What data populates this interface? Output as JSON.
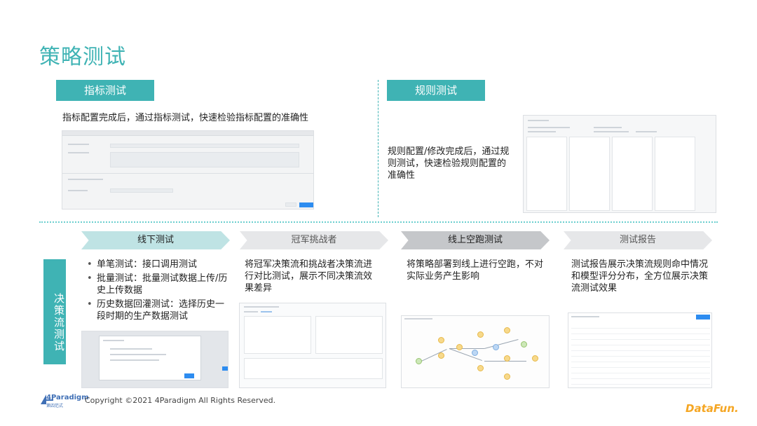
{
  "page": {
    "title": "策略测试"
  },
  "indicator_test": {
    "tag": "指标测试",
    "description": "指标配置完成后，通过指标测试，快速检验指标配置的准确性"
  },
  "rule_test": {
    "tag": "规则测试",
    "description": "规则配置/修改完成后，通过规则测试，快速检验规则配置的准确性"
  },
  "decision_flow": {
    "side_label": "决策流测试",
    "steps": [
      {
        "label": "线下测试"
      },
      {
        "label": "冠军挑战者"
      },
      {
        "label": "线上空跑测试"
      },
      {
        "label": "测试报告"
      }
    ],
    "offline_bullets": [
      "单笔测试：接口调用测试",
      "批量测试：批量测试数据上传/历史上传数据",
      "历史数据回灌测试：选择历史一段时期的生产数据测试"
    ],
    "champion_desc": "将冠军决策流和挑战者决策流进行对比测试，展示不同决策流效果差异",
    "online_desc": "将策略部署到线上进行空跑，不对实际业务产生影响",
    "report_desc": "测试报告展示决策流规则命中情况和模型评分分布，全方位展示决策流测试效果"
  },
  "footer": {
    "logo_text": "4Paradigm",
    "logo_sub": "第四范式",
    "copyright": "Copyright ©2021 4Paradigm All Rights Reserved.",
    "brand": "DataFun."
  },
  "colors": {
    "accent": "#3fb3b4",
    "brand_orange": "#f5a623"
  }
}
